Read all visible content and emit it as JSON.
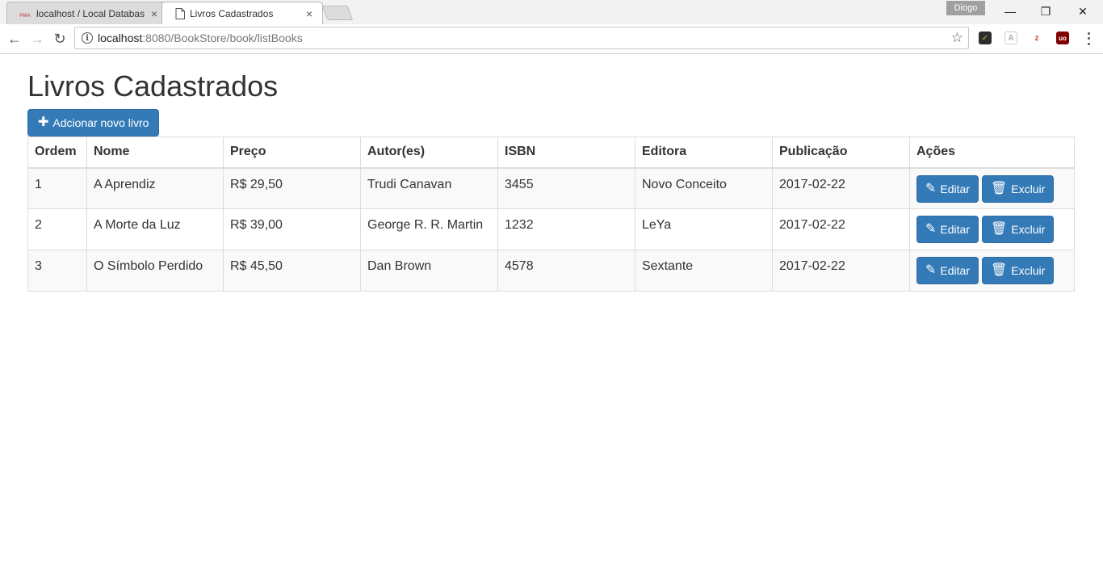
{
  "browser": {
    "tabs": [
      {
        "title": "localhost / Local Databas",
        "icon": "phpmyadmin-favicon",
        "favicon_text": "PMA",
        "close": "×"
      },
      {
        "title": "Livros Cadastrados",
        "icon": "page-icon",
        "close": "×"
      }
    ],
    "profile_name": "Diogo",
    "window": {
      "minimize": "—",
      "restore": "❐",
      "close": "✕"
    },
    "nav": {
      "back": "←",
      "forward": "→",
      "reload": "↻"
    },
    "address": {
      "host": "localhost",
      "path": ":8080/BookStore/book/listBooks",
      "info": "i",
      "star": "☆"
    },
    "extensions": [
      {
        "name": "checkmark-extension-icon",
        "glyph": "✓",
        "bg": "#2c2c2c",
        "color": "#9ed93a"
      },
      {
        "name": "angular-extension-icon",
        "glyph": "A",
        "bg": "#ffffff",
        "color": "#aaaaaa"
      },
      {
        "name": "zotero-extension-icon",
        "glyph": "z",
        "bg": "#ffffff",
        "color": "#e03b3b"
      },
      {
        "name": "ublock-extension-icon",
        "glyph": "uo",
        "bg": "#800000",
        "color": "#ffffff"
      }
    ]
  },
  "page": {
    "title": "Livros Cadastrados",
    "add_button": {
      "icon": "plus-icon",
      "glyph": "✚",
      "label": "Adcionar novo livro"
    },
    "table": {
      "headers": [
        "Ordem",
        "Nome",
        "Preço",
        "Autor(es)",
        "ISBN",
        "Editora",
        "Publicação",
        "Ações"
      ],
      "rows": [
        {
          "ordem": "1",
          "nome": "A Aprendiz",
          "preco": "R$ 29,50",
          "autores": "Trudi Canavan",
          "isbn": "3455",
          "editora": "Novo Conceito",
          "publicacao": "2017-02-22"
        },
        {
          "ordem": "2",
          "nome": "A Morte da Luz",
          "preco": "R$ 39,00",
          "autores": "George R. R. Martin",
          "isbn": "1232",
          "editora": "LeYa",
          "publicacao": "2017-02-22"
        },
        {
          "ordem": "3",
          "nome": "O Símbolo Perdido",
          "preco": "R$ 45,50",
          "autores": "Dan Brown",
          "isbn": "4578",
          "editora": "Sextante",
          "publicacao": "2017-02-22"
        }
      ],
      "edit_label": "Editar",
      "edit_icon": {
        "name": "pencil-icon",
        "glyph": "✎"
      },
      "delete_label": "Excluir",
      "delete_icon": {
        "name": "trash-icon",
        "glyph": "🗑"
      }
    }
  },
  "colors": {
    "primary": "#337ab7",
    "primary_border": "#2e6da4",
    "stripe": "#f9f9f9",
    "border": "#dddddd"
  }
}
